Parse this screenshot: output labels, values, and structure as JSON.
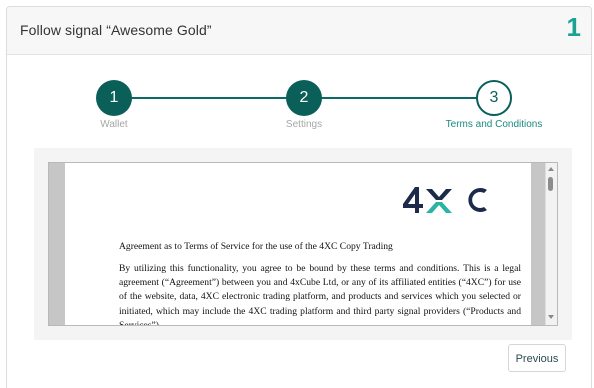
{
  "header": {
    "title": "Follow signal “Awesome Gold”",
    "step_counter": "1"
  },
  "stepper": {
    "steps": [
      {
        "number": "1",
        "label": "Wallet",
        "state": "completed"
      },
      {
        "number": "2",
        "label": "Settings",
        "state": "completed"
      },
      {
        "number": "3",
        "label": "Terms and Conditions",
        "state": "current"
      }
    ]
  },
  "document": {
    "logo_text": "4XC",
    "heading": "Agreement as to Terms of Service for the use of the 4XC Copy Trading",
    "body": "By utilizing this functionality, you agree to be bound by these terms and conditions. This is a legal agreement (“Agreement”) between you and 4xCube Ltd, or any of its affiliated entities (“4XC”) for use of the website, data, 4XC electronic trading platform, and products and services which you selected or initiated, which may include the 4XC trading platform and third party signal providers (“Products and Services”)."
  },
  "footer": {
    "previous_label": "Previous"
  },
  "colors": {
    "accent": "#0a5f59",
    "accent_light": "#1ba295",
    "logo_dark": "#1d2b4a",
    "logo_teal": "#2bb3a3"
  }
}
